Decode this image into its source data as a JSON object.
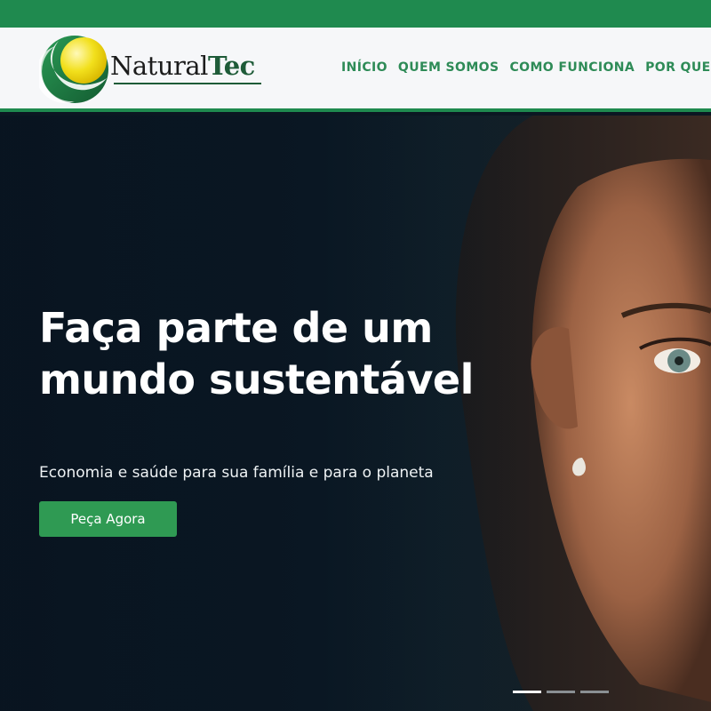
{
  "brand": {
    "name_part1": "Natural",
    "name_part2": "Tec",
    "logo_colors": {
      "green": "#1e7a46",
      "yellow": "#f2e01c"
    }
  },
  "nav": {
    "items": [
      "INÍCIO",
      "QUEM SOMOS",
      "COMO FUNCIONA",
      "POR QUE"
    ]
  },
  "hero": {
    "title_line1": "Faça parte de um",
    "title_line2": "mundo sustentável",
    "subtitle": "Economia e saúde para sua família e para o planeta",
    "cta_label": "Peça Agora",
    "slider": {
      "slides": 3,
      "active": 1
    }
  },
  "colors": {
    "accent_green": "#1f8a4f",
    "button_green": "#2f9a53",
    "nav_text": "#2e8b57",
    "hero_bg": "#0a1723"
  }
}
